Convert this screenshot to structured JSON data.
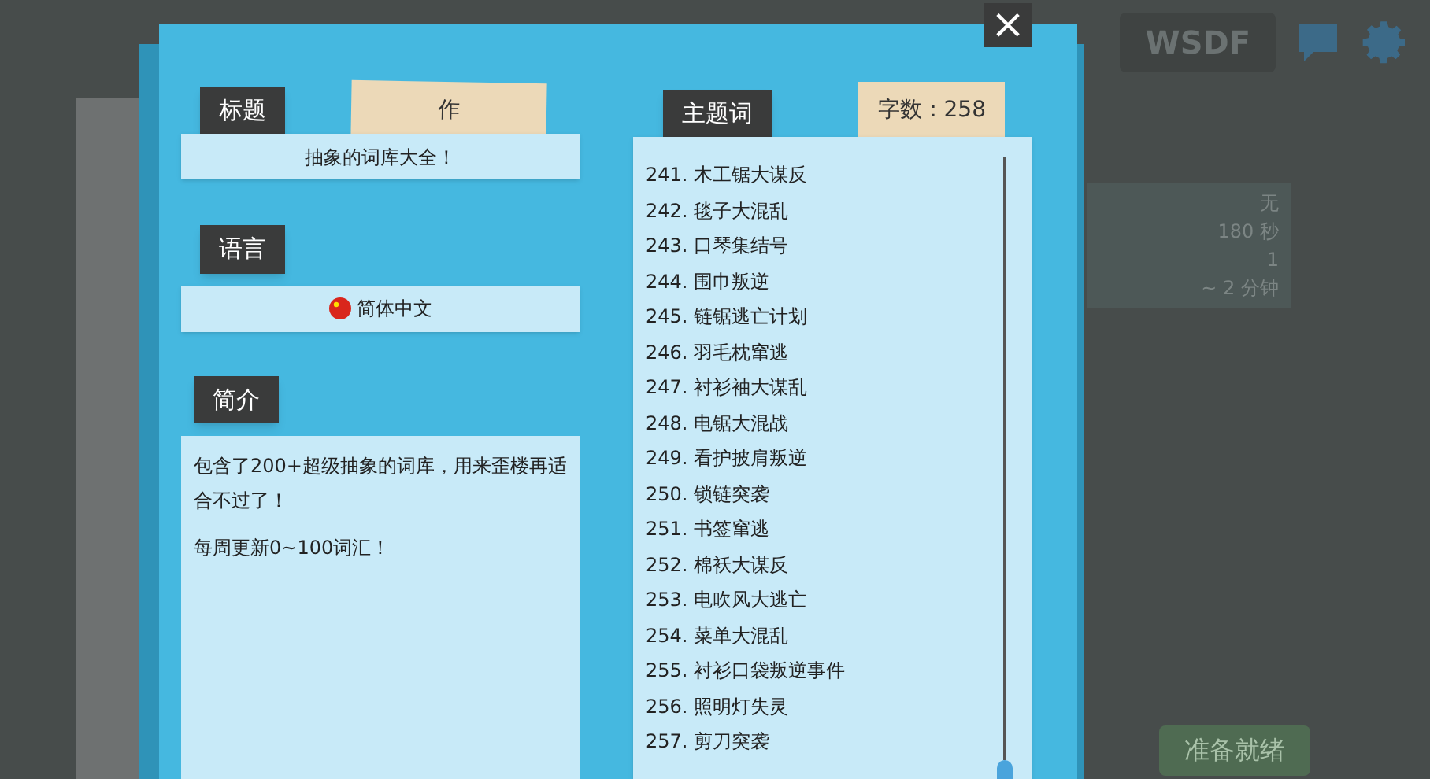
{
  "background": {
    "room_code": "WSDF",
    "stats": [
      "无",
      "180 秒",
      "1",
      "~ 2 分钟"
    ],
    "ready_button": "准备就绪"
  },
  "dialog": {
    "close": "×",
    "title": {
      "label": "标题",
      "author_note": "作",
      "value": "抽象的词库大全！"
    },
    "language": {
      "label": "语言",
      "value": "简体中文"
    },
    "intro": {
      "label": "简介",
      "paragraphs": [
        "包含了200+超级抽象的词库，用来歪楼再适合不过了！",
        "每周更新0~100词汇！"
      ]
    },
    "words": {
      "label": "主题词",
      "count": "字数：258",
      "items": [
        "241. 木工锯大谋反",
        "242. 毯子大混乱",
        "243. 口琴集结号",
        "244. 围巾叛逆",
        "245. 链锯逃亡计划",
        "246. 羽毛枕窜逃",
        "247. 衬衫袖大谋乱",
        "248. 电锯大混战",
        "249. 看护披肩叛逆",
        "250. 锁链突袭",
        "251. 书签窜逃",
        "252. 棉袄大谋反",
        "253. 电吹风大逃亡",
        "254. 菜单大混乱",
        "255. 衬衫口袋叛逆事件",
        "256. 照明灯失灵",
        "257. 剪刀突袭"
      ]
    }
  }
}
